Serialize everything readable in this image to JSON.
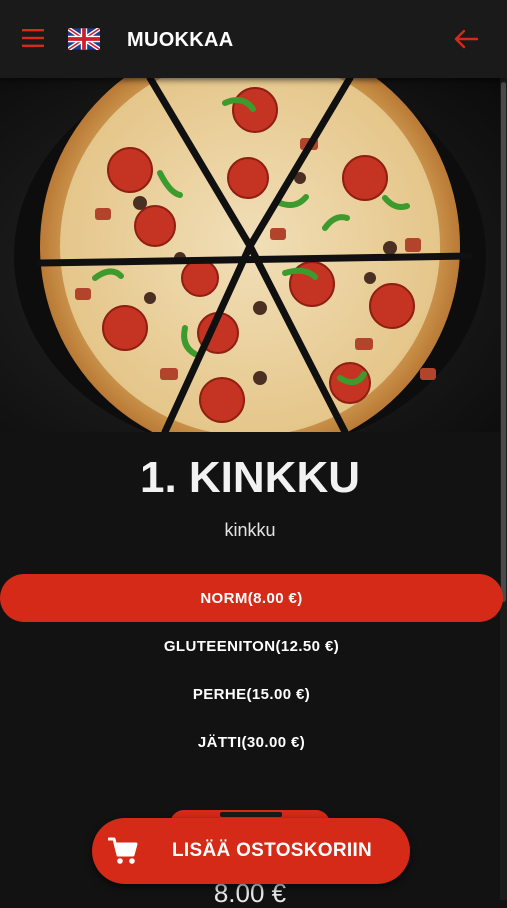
{
  "header": {
    "title": "MUOKKAA",
    "menu_icon": "hamburger-menu-icon",
    "language_icon": "uk-flag-icon",
    "back_icon": "arrow-left-icon"
  },
  "hero": {
    "image": "pizza-photo"
  },
  "product": {
    "name": "1. KINKKU",
    "description": "kinkku"
  },
  "sizes": [
    {
      "label": "NORM(8.00 €)",
      "selected": true
    },
    {
      "label": "GLUTEENITON(12.50 €)",
      "selected": false
    },
    {
      "label": "PERHE(15.00 €)",
      "selected": false
    },
    {
      "label": "JÄTTI(30.00 €)",
      "selected": false
    }
  ],
  "price": "8.00 €",
  "cart_button": {
    "label": "LISÄÄ OSTOSKORIIN",
    "icon": "shopping-cart-icon"
  },
  "colors": {
    "accent": "#d42a17",
    "header_bg": "#1a1a1a",
    "page_bg": "#121212"
  }
}
